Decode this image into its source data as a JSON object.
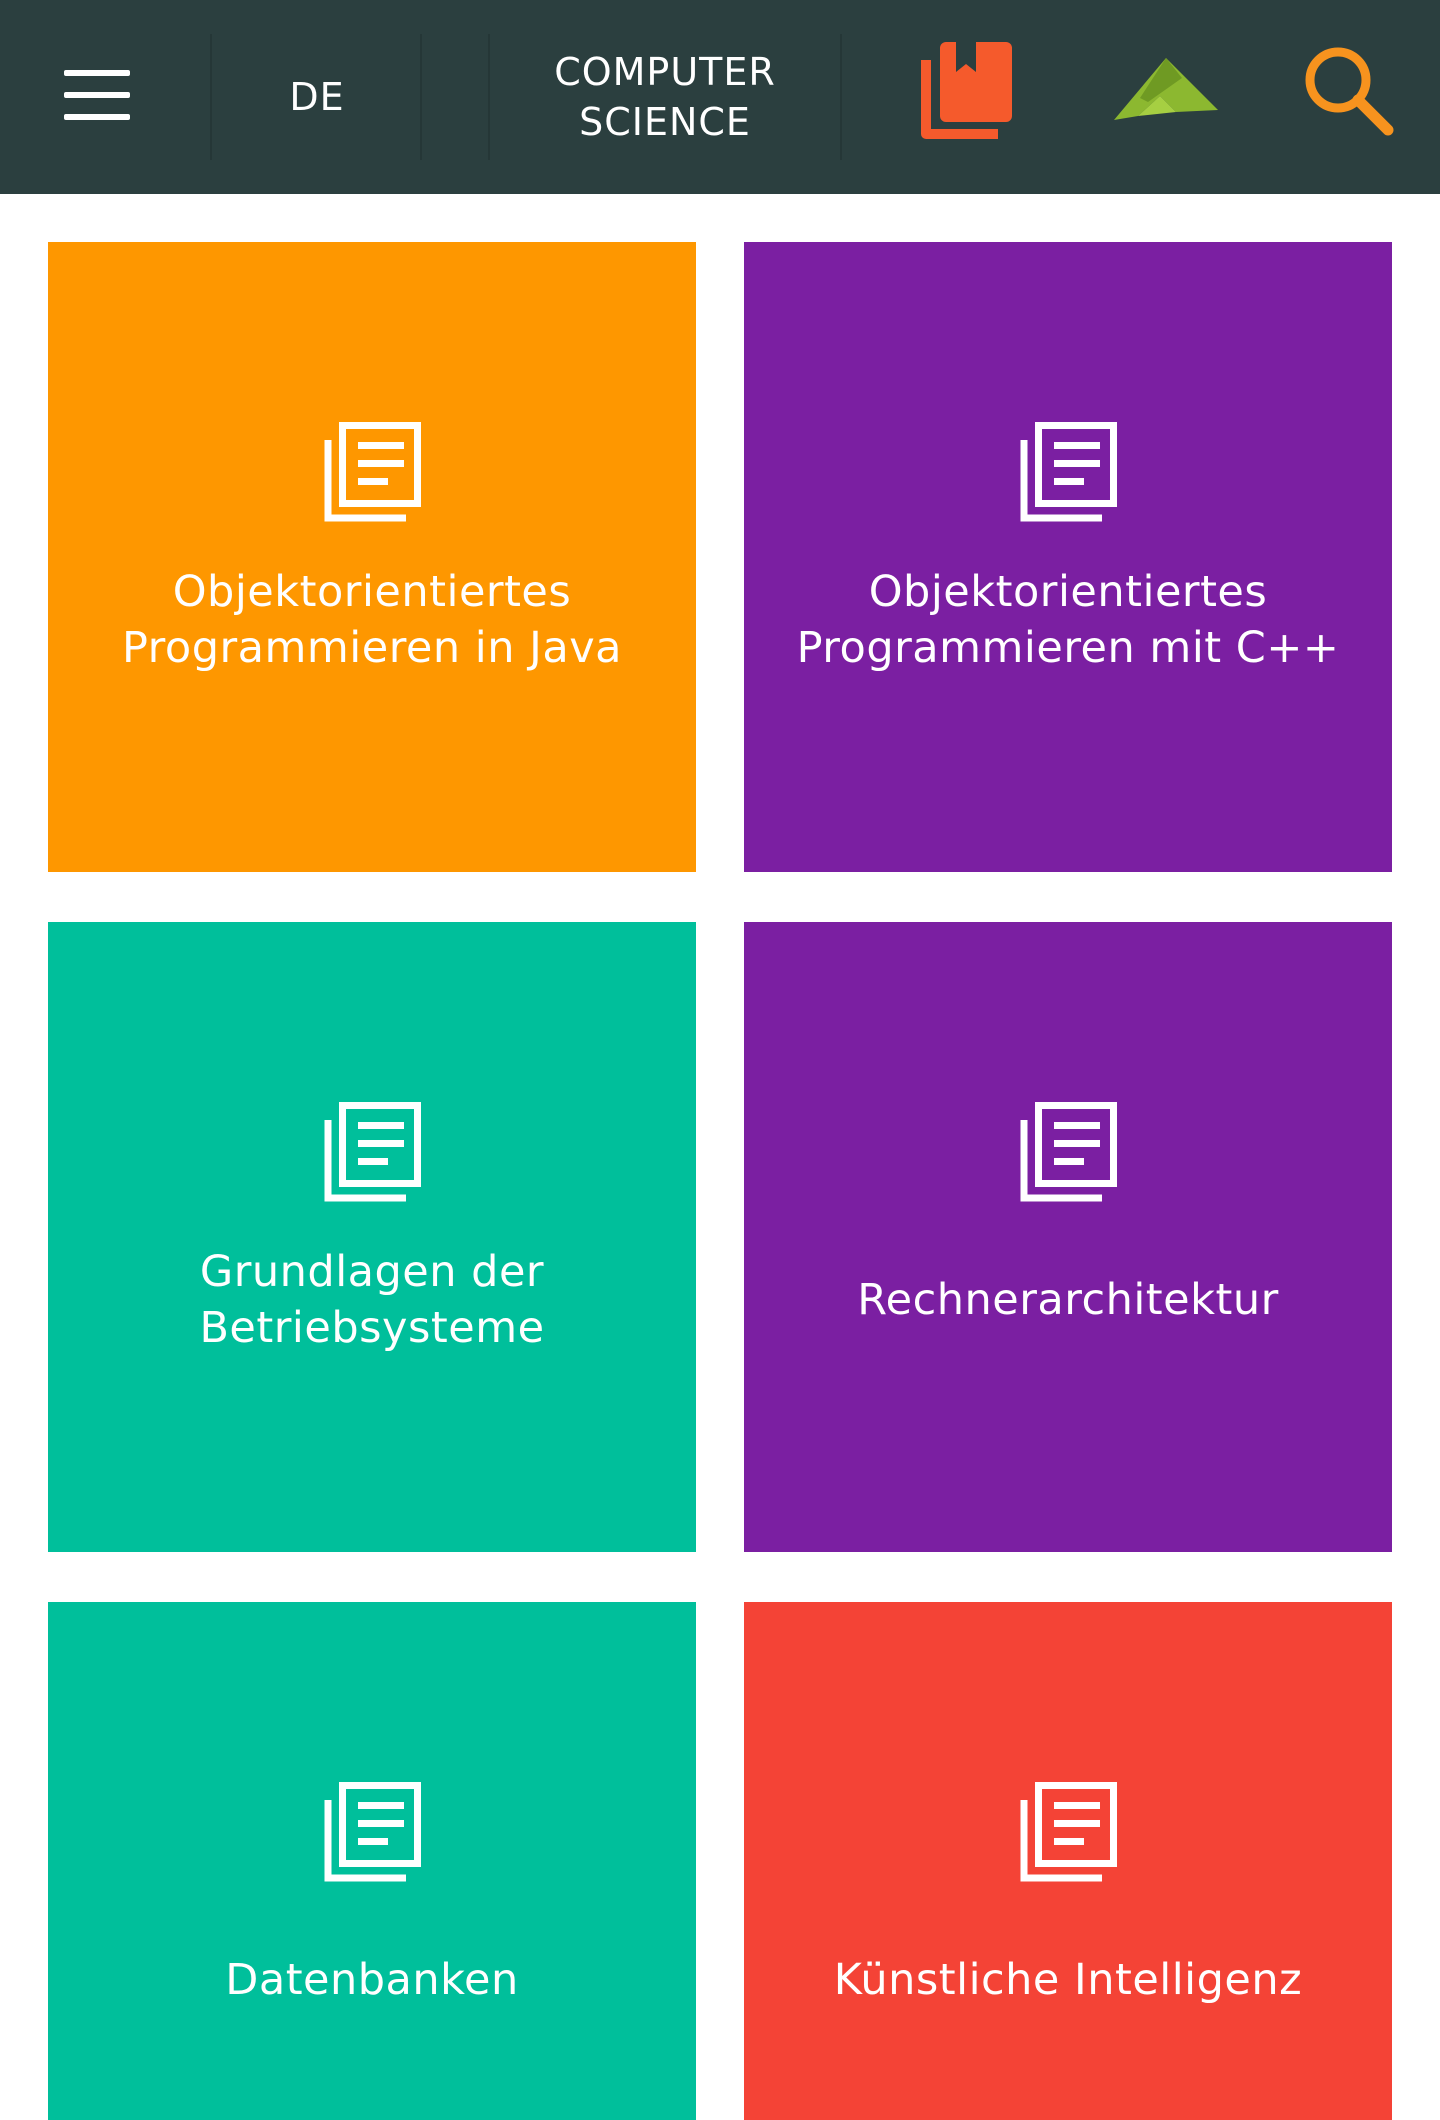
{
  "header": {
    "language": "DE",
    "section_title": "COMPUTER\nSCIENCE",
    "icons": {
      "menu": "hamburger-menu-icon",
      "bookmarks": "bookmarks-icon",
      "logo": "open-book-logo-icon",
      "search": "search-icon"
    },
    "colors": {
      "background": "#2b3f3f",
      "bookmarks": "#f55a2c",
      "logo": "#8cb830",
      "search": "#f7931e"
    }
  },
  "tiles": [
    {
      "label": "Objektorientiertes\nProgrammieren in Java",
      "color": "#fe9700",
      "icon": "document-icon"
    },
    {
      "label": "Objektorientiertes\nProgrammieren mit C++",
      "color": "#7b1fa2",
      "icon": "document-icon"
    },
    {
      "label": "Grundlagen der\nBetriebsysteme",
      "color": "#00bf9b",
      "icon": "document-icon"
    },
    {
      "label": "Rechnerarchitektur",
      "color": "#7b1fa2",
      "icon": "document-icon"
    },
    {
      "label": "Datenbanken",
      "color": "#00bf9b",
      "icon": "document-icon"
    },
    {
      "label": "Künstliche Intelligenz",
      "color": "#f44336",
      "icon": "document-icon"
    }
  ]
}
